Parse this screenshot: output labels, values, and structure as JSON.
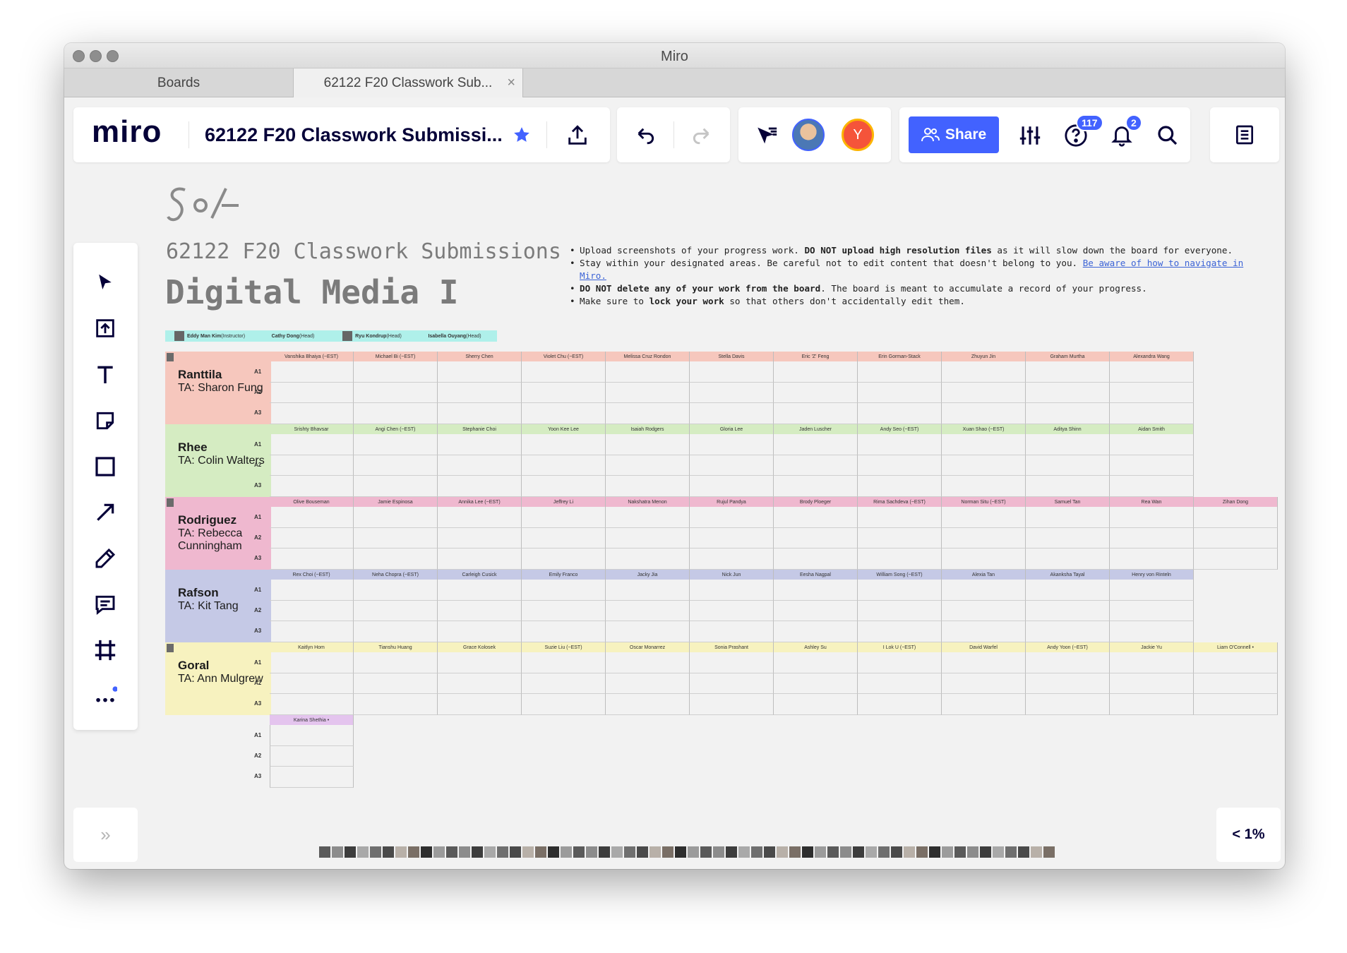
{
  "window": {
    "title": "Miro"
  },
  "tabs": [
    {
      "label": "Boards"
    },
    {
      "label": "62122 F20 Classwork Sub..."
    }
  ],
  "header": {
    "logo": "miro",
    "board_title": "62122 F20 Classwork Submissi...",
    "share_label": "Share",
    "help_badge": "117",
    "notifications_badge": "2",
    "user_initial": "Y"
  },
  "board": {
    "course_line": "62122 F20 Classwork Submissions",
    "course_title": "Digital Media I",
    "rules": [
      {
        "pre": "Upload screenshots of your progress work. ",
        "bold": "DO NOT upload high resolution files",
        "post": " as it will slow down the board for everyone."
      },
      {
        "pre": "Stay within your designated areas. Be careful not to edit content that doesn't belong to you. ",
        "link": "Be aware of how to navigate in Miro."
      },
      {
        "bold": "DO NOT delete any of your work from the board",
        "post": ". The board is meant to accumulate a record of your progress."
      },
      {
        "pre": "Make sure to ",
        "bold": "lock your work",
        "post": " so that others don't accidentally edit them."
      }
    ],
    "instructors": [
      {
        "name": "Eddy Man Kim",
        "role": "(Instructor)"
      },
      {
        "name": "Cathy Dong",
        "role": "(Head)"
      },
      {
        "name": "Ryu Kondrup",
        "role": "(Head)"
      },
      {
        "name": "Isabella Ouyang",
        "role": "(Head)"
      }
    ],
    "row_labels": [
      "A1",
      "A2",
      "A3"
    ],
    "sections": [
      {
        "name": "Ranttila",
        "ta": "TA: Sharon Fung",
        "color": "#f6c7bd",
        "head_color": "#f6c7bd",
        "students": [
          "Vanshika Bhaiya (~EST)",
          "Michael Bi (~EST)",
          "Sherry Chen",
          "Violet Chu (~EST)",
          "Melissa Cruz Rondon",
          "Stella Davis",
          "Eric 'Z' Feng",
          "Erin Gorman-Stack",
          "Zhuyun Jin",
          "Graham Murtha",
          "Alexandra Wang"
        ]
      },
      {
        "name": "Rhee",
        "ta": "TA: Colin Walters",
        "color": "#d5ecc2",
        "head_color": "#d5ecc2",
        "students": [
          "Srishty Bhavsar",
          "Angi Chen (~EST)",
          "Stephanie Choi",
          "Yoon Kee Lee",
          "Isaiah Rodgers",
          "Gloria Lee",
          "Jaden Luscher",
          "Andy Seo (~EST)",
          "Xuan Shao (~EST)",
          "Aditya Shinn",
          "Aidan Smith"
        ]
      },
      {
        "name": "Rodriguez",
        "ta": "TA: Rebecca Cunningham",
        "color": "#efb8cf",
        "head_color": "#efb8cf",
        "students": [
          "Olive Bouseman",
          "Jamie Espinosa",
          "Annika Lee (~EST)",
          "Jeffrey Li",
          "Nakshatra Menon",
          "Rujul Pandya",
          "Brody Ploeger",
          "Rima Sachdeva (~EST)",
          "Norman Situ (~EST)",
          "Samuel Tan",
          "Rea Wan",
          "Zihan Dong"
        ]
      },
      {
        "name": "Rafson",
        "ta": "TA: Kit Tang",
        "color": "#c5c9e6",
        "head_color": "#c5c9e6",
        "students": [
          "Rex Choi (~EST)",
          "Neha Chopra (~EST)",
          "Carleigh Cusick",
          "Emily Franco",
          "Jacky Jia",
          "Nick Jun",
          "Eesha Nagpal",
          "William Song (~EST)",
          "Alexia Tan",
          "Akanksha Tayal",
          "Henry von Rinteln"
        ]
      },
      {
        "name": "Goral",
        "ta": "TA: Ann Mulgrew",
        "color": "#f7f2bf",
        "head_color": "#f7f2bf",
        "students": [
          "Kaitlyn Hom",
          "Tianshu Huang",
          "Grace Kolosek",
          "Suzie Liu (~EST)",
          "Oscar Monarrez",
          "Sonia Prashant",
          "Ashley Su",
          "I Lok U (~EST)",
          "David Warfel",
          "Andy Yoon (~EST)",
          "Jackie Yu",
          "Liam O'Connell •"
        ]
      }
    ],
    "extra_student": "Karina Shethia •",
    "extra_color": "#e4c4ee"
  },
  "zoom_label": "< 1%",
  "expand_label": "»",
  "colors": {
    "accent": "#4262ff",
    "user_avatar": "#f5543a"
  }
}
